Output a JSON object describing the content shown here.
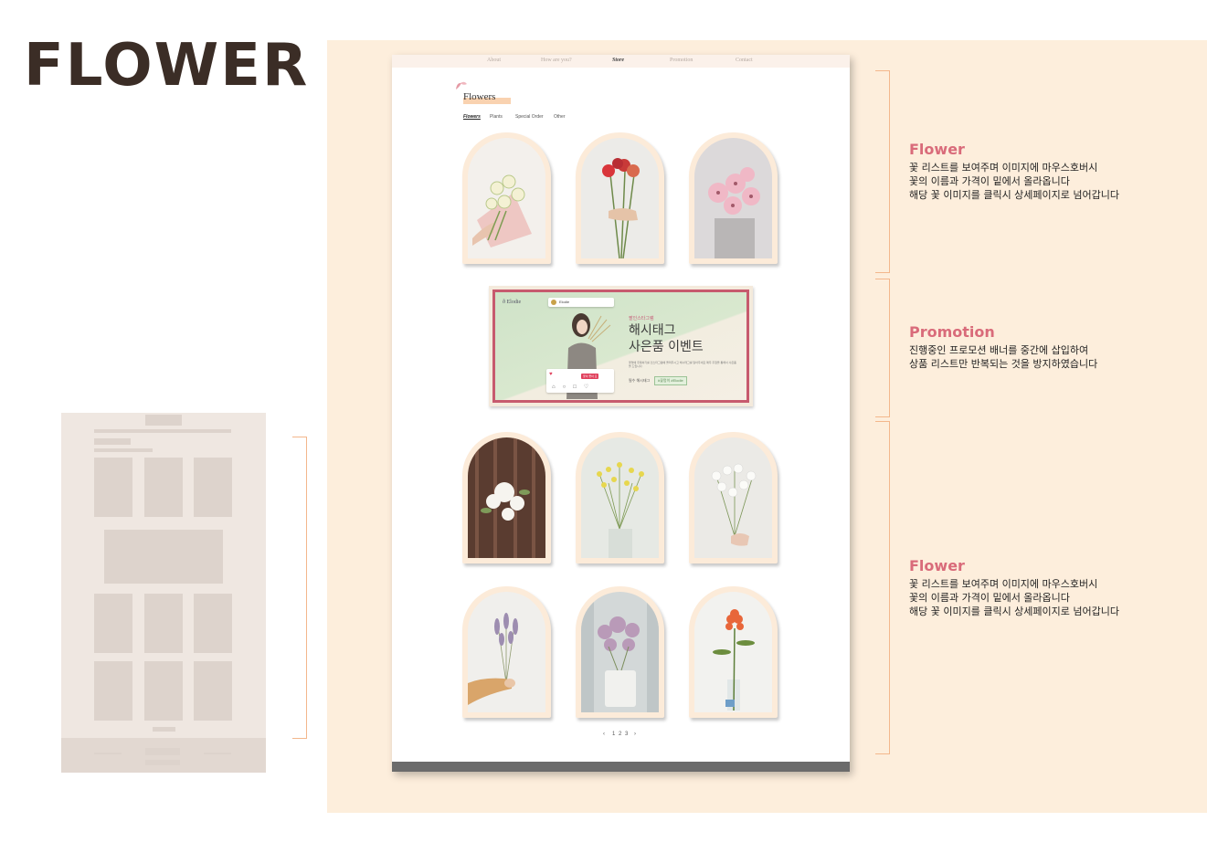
{
  "page": {
    "title": "FLOWER"
  },
  "site": {
    "nav": [
      {
        "label": "About",
        "active": false
      },
      {
        "label": "How are you?",
        "active": false
      },
      {
        "label": "Store",
        "active": true
      },
      {
        "label": "Promotion",
        "active": false
      },
      {
        "label": "Contact",
        "active": false
      }
    ],
    "category_title": "Flowers",
    "tabs": [
      {
        "label": "Flowers",
        "active": true
      },
      {
        "label": "Plants",
        "active": false
      },
      {
        "label": "Special Order",
        "active": false
      },
      {
        "label": "Other",
        "active": false
      }
    ],
    "banner": {
      "brand": "ð Elodie",
      "small": "팔인스타그램",
      "headline_1": "해시태그",
      "headline_2": "사은품 이벤트",
      "description": "꽃멍에 주목하기를 인스타그램에 올려주시고 해시태그를 달아주세요 매주 추첨을 통해서 사은품을 드립니다.",
      "tag_label": "필수 해시태그",
      "tag": "#꽃멍이 #Elodie",
      "post_user": "Elodie",
      "post_button": "꽃이 좋아 요"
    },
    "pagination": [
      "‹",
      "1",
      "2",
      "3",
      "›"
    ]
  },
  "notes": [
    {
      "title": "Flower",
      "body": "꽃 리스트를 보여주며 이미지에 마우스호버시\n꽃의 이름과 가격이 밑에서 올라옵니다\n해당 꽃 이미지를 클릭시 상세페이지로 넘어갑니다"
    },
    {
      "title": "Promotion",
      "body": "진행중인 프로모션 배너를 중간에 삽입하여\n상품 리스트만 반복되는 것을 방지하였습니다"
    },
    {
      "title": "Flower",
      "body": "꽃 리스트를 보여주며 이미지에 마우스호버시\n꽃의 이름과 가격이 밑에서 올라옵니다\n해당 꽃 이미지를 클릭시 상세페이지로 넘어갑니다"
    }
  ],
  "colors": {
    "title": "#3b2d26",
    "panel": "#fdeedc",
    "accent": "#d96b7a",
    "bracket": "#f3b78c"
  }
}
